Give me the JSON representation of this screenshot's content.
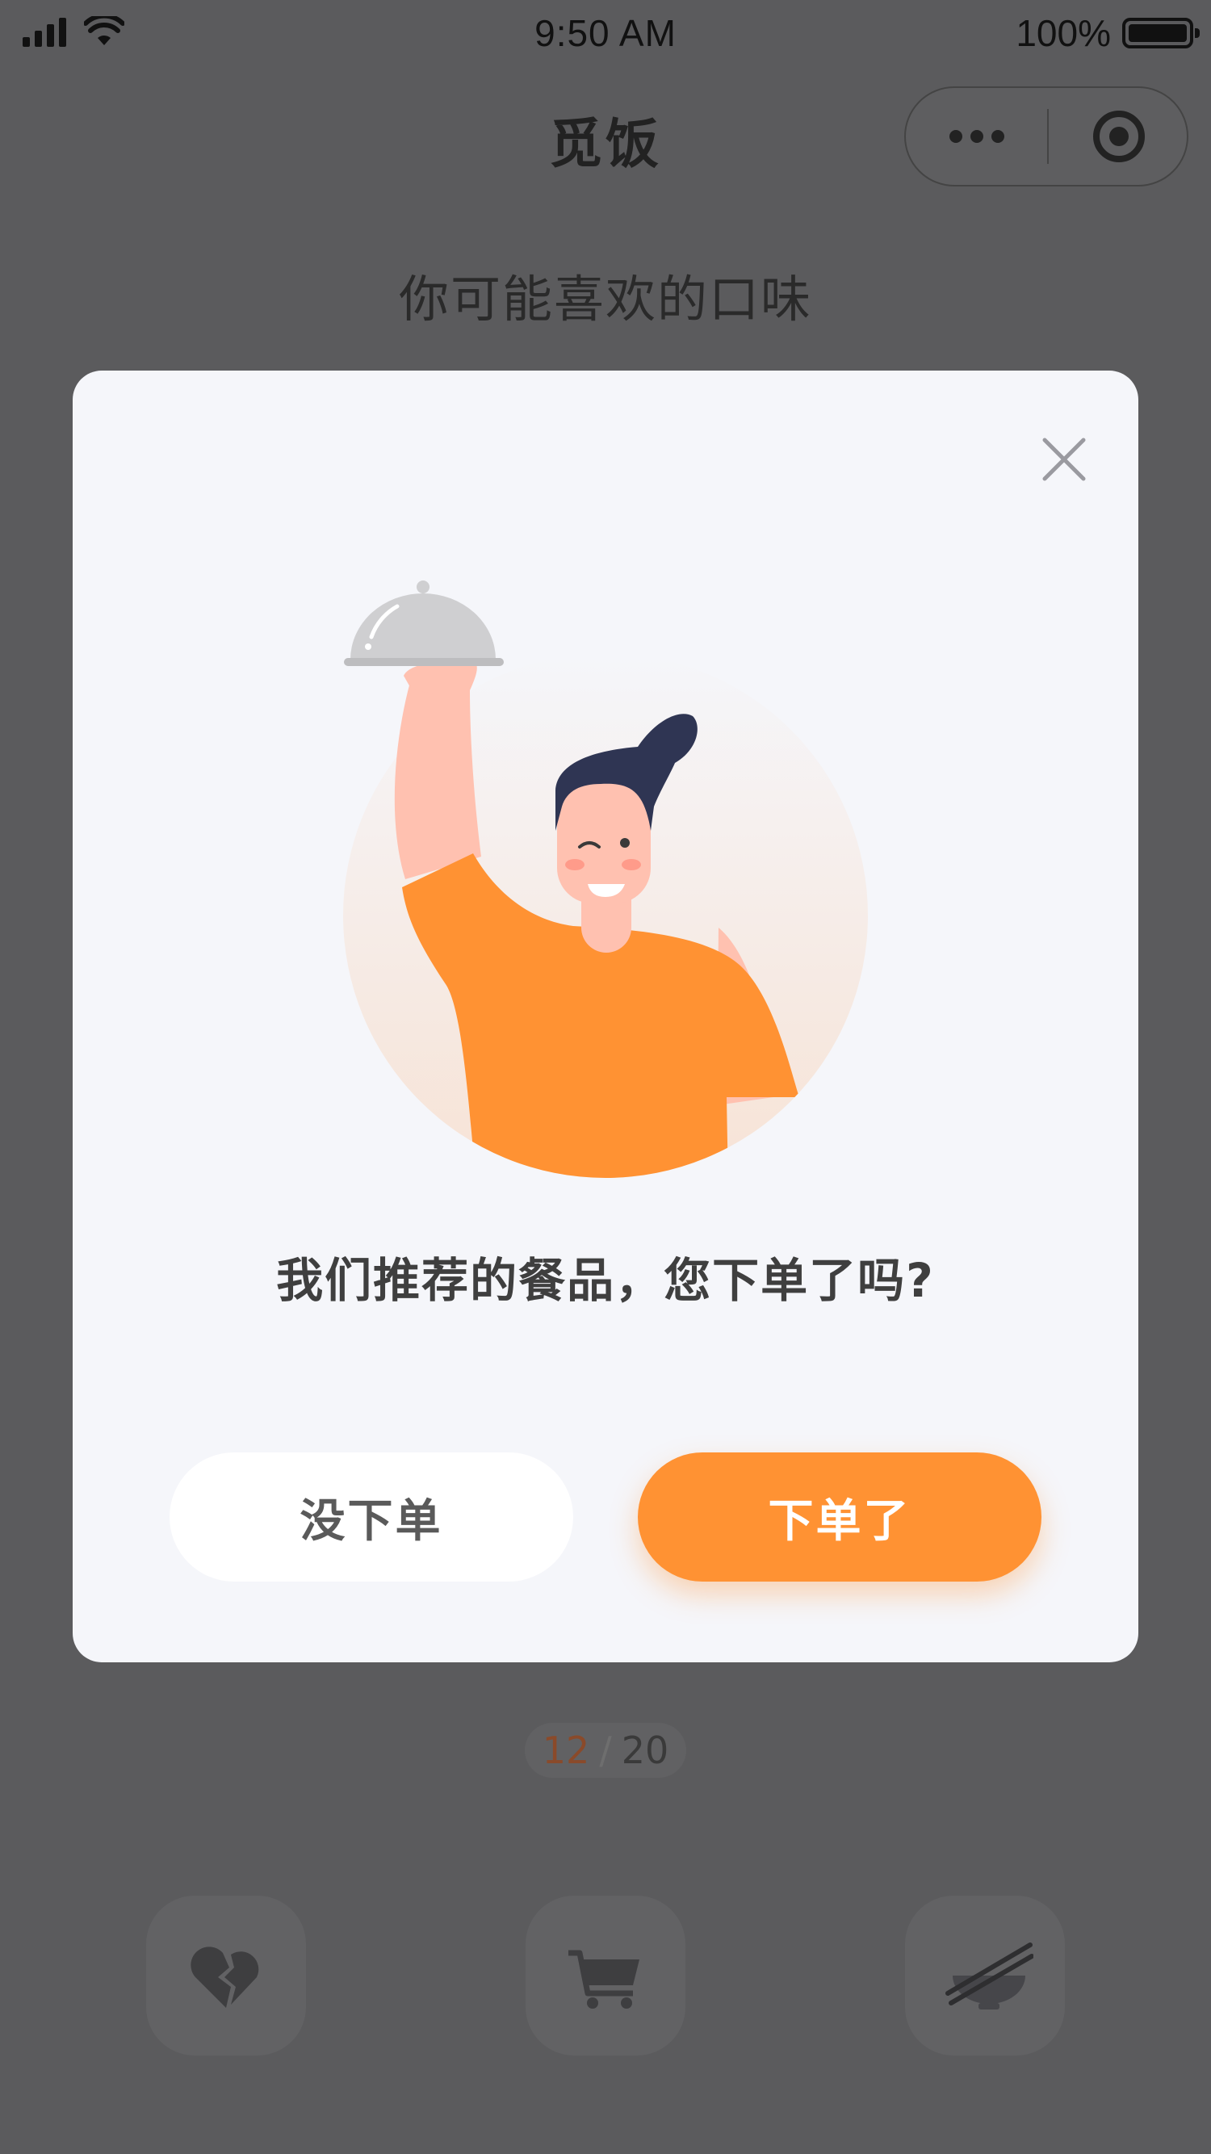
{
  "status_bar": {
    "time": "9:50 AM",
    "battery": "100%"
  },
  "nav": {
    "title": "觅饭"
  },
  "page": {
    "subtitle": "你可能喜欢的口味"
  },
  "counter": {
    "current": "12",
    "separator": "/",
    "total": "20"
  },
  "actions": [
    {
      "icon": "broken-heart-icon"
    },
    {
      "icon": "cart-icon"
    },
    {
      "icon": "bowl-chopsticks-icon"
    }
  ],
  "modal": {
    "question": "我们推荐的餐品，您下单了吗?",
    "no_label": "没下单",
    "yes_label": "下单了"
  },
  "colors": {
    "accent": "#ff9233",
    "overlay": "#5b5b5d",
    "modal_bg": "#f5f6fa"
  }
}
